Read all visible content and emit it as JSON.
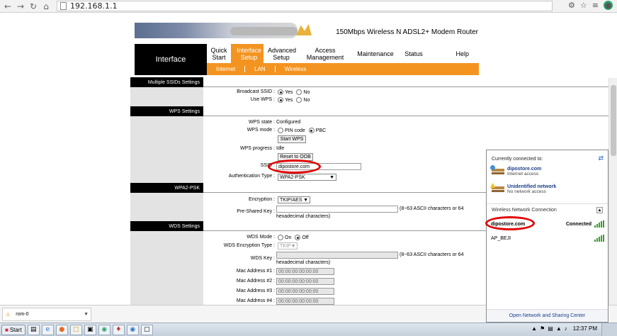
{
  "browser": {
    "url": "192.168.1.1",
    "back_icon": "back-arrow-icon",
    "forward_icon": "forward-arrow-icon",
    "reload_icon": "reload-icon",
    "home_icon": "home-icon"
  },
  "router": {
    "model": "150Mbps Wireless N ADSL2+ Modem Router",
    "section": "Interface",
    "tabs": [
      {
        "label": "Quick Start"
      },
      {
        "label": "Interface Setup"
      },
      {
        "label": "Advanced Setup"
      },
      {
        "label": "Access Management"
      },
      {
        "label": "Maintenance"
      },
      {
        "label": "Status"
      },
      {
        "label": "Help"
      }
    ],
    "subtabs": [
      "Internet",
      "LAN",
      "Wireless"
    ]
  },
  "multi_ssid": {
    "heading": "Multiple SSIDs Settings",
    "broadcast_label": "Broadcast SSID :",
    "use_wps_label": "Use WPS :",
    "yes": "Yes",
    "no": "No"
  },
  "wps": {
    "heading": "WPS Settings",
    "state_label": "WPS state :",
    "state_value": "Configured",
    "mode_label": "WPS mode :",
    "pin": "PIN code",
    "pbc": "PBC",
    "start_button": "Start WPS",
    "progress_label": "WPS progress :",
    "progress_value": "Idle",
    "reset_button": "Reset to OOB",
    "ssid_label": "SSID :",
    "ssid_value": "dipostore.com",
    "auth_label": "Authentication Type :",
    "auth_value": "WPA2-PSK"
  },
  "wpa2": {
    "heading": "WPA2-PSK",
    "encryption_label": "Encryption :",
    "encryption_value": "TKIP/AES",
    "psk_label": "Pre-Shared Key :",
    "psk_hint": "(8~63 ASCII characters or 64",
    "psk_hint2": "hexadecimal characters)"
  },
  "wds": {
    "heading": "WDS Settings",
    "mode_label": "WDS Mode :",
    "on": "On",
    "off": "Off",
    "enc_label": "WDS Encryption Type :",
    "enc_value": "TKIP",
    "key_label": "WDS Key :",
    "key_hint": "(8~63 ASCII characters or 64",
    "key_hint2": "hexadecimal characters)",
    "macs": [
      {
        "label": "Mac Address #1 :",
        "value": "00:00:00:00:00:00"
      },
      {
        "label": "Mac Address #2 :",
        "value": "00:00:00:00:00:00"
      },
      {
        "label": "Mac Address #3 :",
        "value": "00:00:00:00:00:00"
      },
      {
        "label": "Mac Address #4 :",
        "value": "00:00:00:00:00:00"
      }
    ]
  },
  "download": {
    "file": "rom-0"
  },
  "network_panel": {
    "header": "Currently connected to:",
    "networks": [
      {
        "name": "dipostore.com",
        "sub": "Internet access"
      },
      {
        "name": "Unidentified network",
        "sub": "No network access"
      }
    ],
    "wireless_section": "Wireless Network Connection",
    "wifi": [
      {
        "name": "dipostore.com",
        "status": "Connected"
      },
      {
        "name": "AP_BEJI",
        "status": ""
      }
    ],
    "footer": "Open Network and Sharing Center"
  },
  "taskbar": {
    "start": "Start",
    "clock": "12:37 PM"
  },
  "colors": {
    "accent": "#f39421",
    "highlight": "#e00000"
  }
}
